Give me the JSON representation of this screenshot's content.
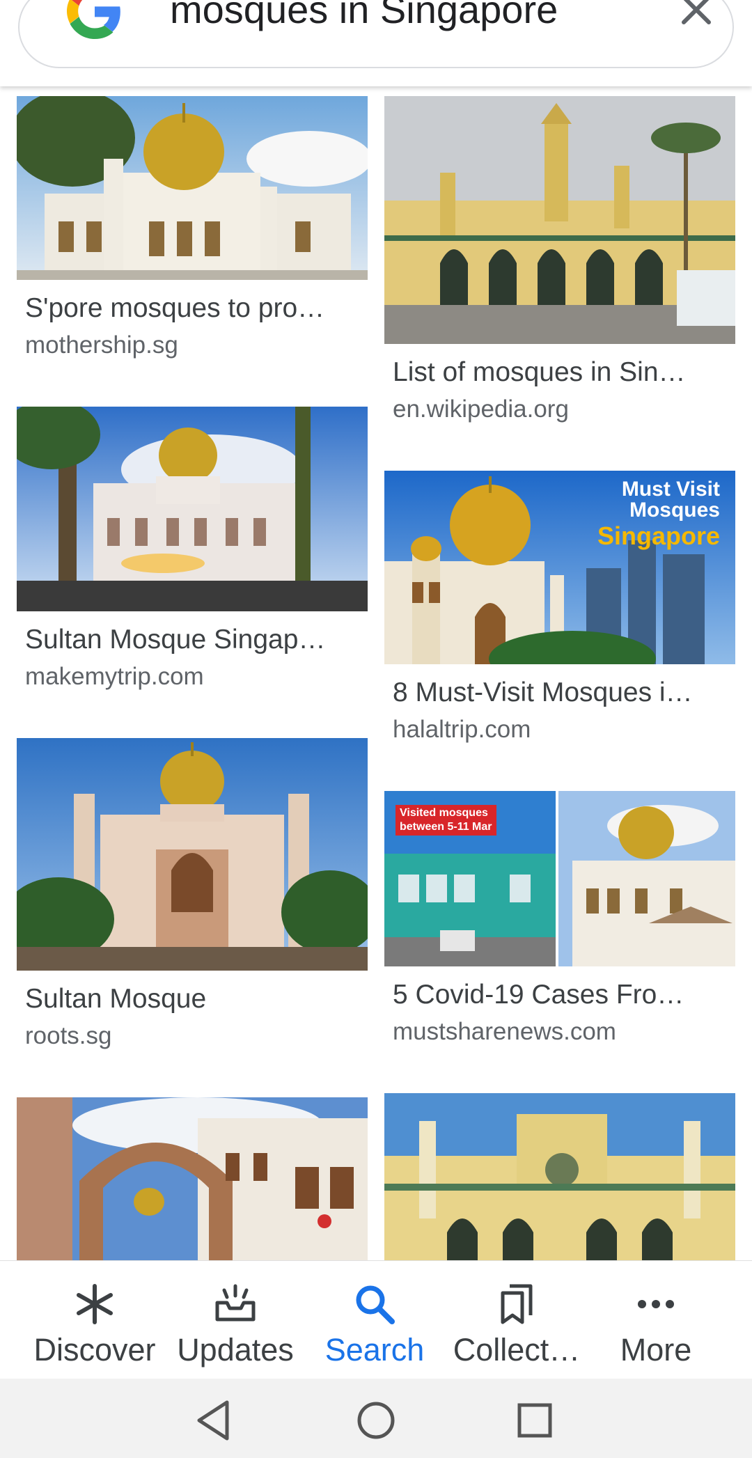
{
  "search": {
    "query": "mosques in Singapore"
  },
  "results": [
    {
      "title": "S'pore mosques to pro…",
      "source": "mothership.sg"
    },
    {
      "title": "List of mosques in Sin…",
      "source": "en.wikipedia.org"
    },
    {
      "title": "Sultan Mosque Singap…",
      "source": "makemytrip.com"
    },
    {
      "title": "8 Must-Visit Mosques i…",
      "source": "halaltrip.com",
      "overlay": [
        "Must Visit",
        "Mosques",
        "Singapore"
      ]
    },
    {
      "title": "Sultan Mosque",
      "source": "roots.sg"
    },
    {
      "title": "5 Covid-19 Cases Fro…",
      "source": "mustsharenews.com",
      "overlay": [
        "Visited mosques",
        "between 5-11 Mar"
      ]
    }
  ],
  "bottom_nav": [
    {
      "label": "Discover",
      "icon": "asterisk-icon"
    },
    {
      "label": "Updates",
      "icon": "updates-tray-icon"
    },
    {
      "label": "Search",
      "icon": "search-icon",
      "active": true
    },
    {
      "label": "Collect…",
      "icon": "bookmarks-icon"
    },
    {
      "label": "More",
      "icon": "more-dots-icon"
    }
  ],
  "colors": {
    "accent": "#1a73e8",
    "text": "#3c4043",
    "source": "#5f6368",
    "dome_gold": "#c9a227",
    "sky": "#4f8fd1"
  }
}
